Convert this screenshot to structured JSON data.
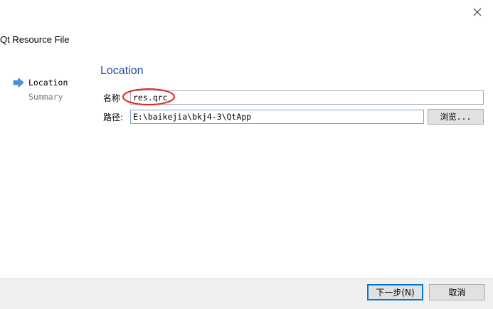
{
  "window": {
    "title": "Qt Resource File",
    "close_icon": "close-icon"
  },
  "steps": [
    {
      "label": "Location",
      "active": true
    },
    {
      "label": "Summary",
      "active": false
    }
  ],
  "page": {
    "heading": "Location"
  },
  "form": {
    "name_label": "名称",
    "name_value": "res.qrc",
    "path_label": "路径:",
    "path_value": "E:\\baikejia\\bkj4-3\\QtApp",
    "browse_label": "浏览..."
  },
  "footer": {
    "next_label": "下一步(N)",
    "cancel_label": "取消"
  },
  "colors": {
    "accent": "#1e4c9a",
    "step_arrow": "#4a90d9",
    "annotation": "#e02020"
  }
}
